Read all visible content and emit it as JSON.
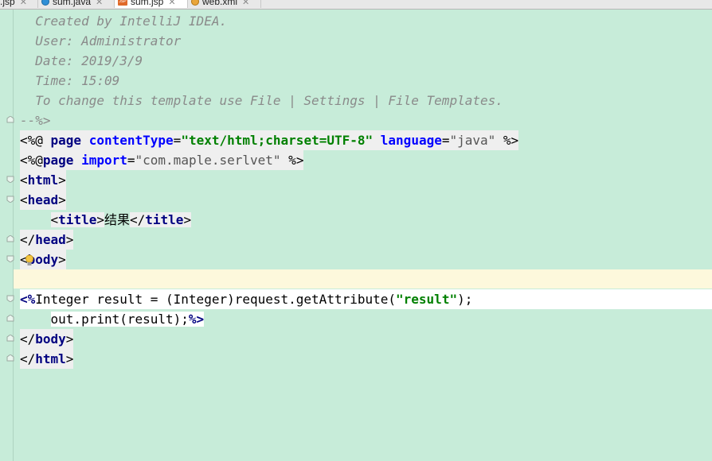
{
  "tabs": [
    {
      "label": ".jsp",
      "icon": "jsp-file-icon",
      "active": false
    },
    {
      "label": "sum.java",
      "icon": "java-class-icon",
      "active": false
    },
    {
      "label": "sum.jsp",
      "icon": "jsp-file-icon",
      "active": true
    },
    {
      "label": "web.xml",
      "icon": "xml-file-icon",
      "active": false
    }
  ],
  "colors": {
    "editor_bg": "#c7ecd9",
    "current_line": "#fdf8dc",
    "comment": "#8a8a8a",
    "tag_name": "#000080",
    "attribute": "#0000ff",
    "string": "#008000"
  },
  "code": {
    "comment_lines": [
      "  Created by IntelliJ IDEA.",
      "  User: Administrator",
      "  Date: 2019/3/9",
      "  Time: 15:09",
      "  To change this template use File | Settings | File Templates."
    ],
    "comment_end": "--%>",
    "page_directive": {
      "open": "<%@ ",
      "keyword": "page",
      "attr1": "contentType",
      "eq1": "=",
      "val1": "\"text/html;charset=UTF-8\"",
      "attr2": "language",
      "eq2": "=",
      "val2": "\"java\"",
      "close": " %>"
    },
    "import_directive": {
      "open": "<%@",
      "keyword": "page",
      "attr": "import",
      "eq": "=",
      "val": "\"com.maple.serlvet\"",
      "close": " %>"
    },
    "html_open": "html",
    "head_open": "head",
    "title_tag": "title",
    "title_text": "结果",
    "head_close": "head",
    "body_open": "body",
    "scriptlet_open": "<%",
    "scriptlet_line1_a": "Integer result = (Integer)request.getAttribute(",
    "scriptlet_line1_str": "\"result\"",
    "scriptlet_line1_b": ");",
    "scriptlet_line2": "out.print(result);",
    "scriptlet_close": "%>",
    "body_close": "body",
    "html_close": "html"
  }
}
